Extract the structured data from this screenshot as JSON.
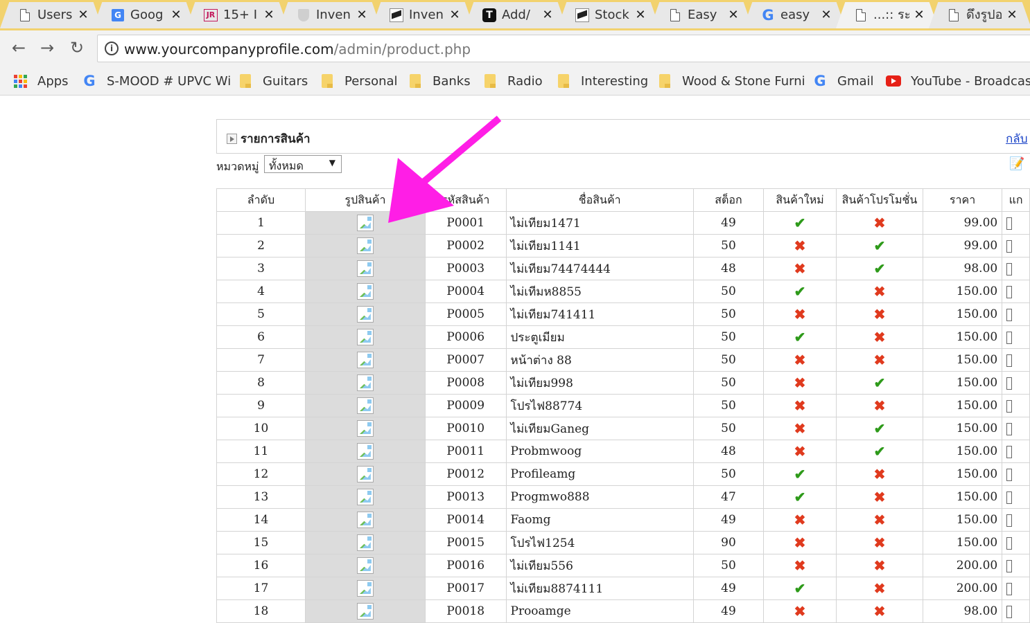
{
  "browser": {
    "tabs": [
      {
        "title": "Users",
        "icon": "document-icon",
        "active": false
      },
      {
        "title": "Goog",
        "icon": "google-translate-icon",
        "active": false
      },
      {
        "title": "15+ I",
        "icon": "jr-icon",
        "active": false
      },
      {
        "title": "Inven",
        "icon": "shield-icon",
        "active": false
      },
      {
        "title": "Inven",
        "icon": "bird-icon",
        "active": false
      },
      {
        "title": "Add/",
        "icon": "t-icon",
        "active": false
      },
      {
        "title": "Stock",
        "icon": "bird-icon",
        "active": false
      },
      {
        "title": "Easy",
        "icon": "document-icon",
        "active": false
      },
      {
        "title": "easy",
        "icon": "google-icon",
        "active": false
      },
      {
        "title": "...:: ระบ",
        "icon": "document-icon",
        "active": true
      },
      {
        "title": "ดึงรูปอ",
        "icon": "document-icon",
        "active": false
      }
    ],
    "close_glyph": "✕",
    "url_host": "www.yourcompanyprofile.com",
    "url_path": "/admin/product.php",
    "bookmarks": [
      {
        "label": "Apps",
        "icon": "apps-grid-icon"
      },
      {
        "label": "S-MOOD # UPVC Wi",
        "icon": "google-icon"
      },
      {
        "label": "Guitars",
        "icon": "folder-icon"
      },
      {
        "label": "Personal",
        "icon": "folder-icon"
      },
      {
        "label": "Banks",
        "icon": "folder-icon"
      },
      {
        "label": "Radio",
        "icon": "folder-icon"
      },
      {
        "label": "Interesting",
        "icon": "folder-icon"
      },
      {
        "label": "Wood & Stone Furni",
        "icon": "folder-icon"
      },
      {
        "label": "Gmail",
        "icon": "google-icon"
      },
      {
        "label": "YouTube - Broadcast",
        "icon": "youtube-icon"
      }
    ]
  },
  "page": {
    "panel_title": "รายการสินค้า",
    "back_link": "กลับ",
    "category_label": "หมวดหมู่",
    "category_selected": "ทั้งหมด",
    "table": {
      "headers": [
        "ลำดับ",
        "รูปสินค้า",
        "รหัสสินค้า",
        "ชื่อสินค้า",
        "สต็อก",
        "สินค้าใหม่",
        "สินค้าโปรโมชั่น",
        "ราคา",
        "แก"
      ],
      "rows": [
        {
          "no": "1",
          "code": "P0001",
          "name": "ไม่เทียม1471",
          "stock": "49",
          "is_new": true,
          "is_promo": false,
          "price": "99.00"
        },
        {
          "no": "2",
          "code": "P0002",
          "name": "ไม่เทียม1141",
          "stock": "50",
          "is_new": false,
          "is_promo": true,
          "price": "99.00"
        },
        {
          "no": "3",
          "code": "P0003",
          "name": "ไม่เทียม74474444",
          "stock": "48",
          "is_new": false,
          "is_promo": true,
          "price": "98.00"
        },
        {
          "no": "4",
          "code": "P0004",
          "name": "ไม่เทีมห8855",
          "stock": "50",
          "is_new": true,
          "is_promo": false,
          "price": "150.00"
        },
        {
          "no": "5",
          "code": "P0005",
          "name": "ไม่เทียม741411",
          "stock": "50",
          "is_new": false,
          "is_promo": false,
          "price": "150.00"
        },
        {
          "no": "6",
          "code": "P0006",
          "name": "ประตูเมียม",
          "stock": "50",
          "is_new": true,
          "is_promo": false,
          "price": "150.00"
        },
        {
          "no": "7",
          "code": "P0007",
          "name": "หน้าต่าง 88",
          "stock": "50",
          "is_new": false,
          "is_promo": false,
          "price": "150.00"
        },
        {
          "no": "8",
          "code": "P0008",
          "name": "ไม่เทียม998",
          "stock": "50",
          "is_new": false,
          "is_promo": true,
          "price": "150.00"
        },
        {
          "no": "9",
          "code": "P0009",
          "name": "โปรไฟ88774",
          "stock": "50",
          "is_new": false,
          "is_promo": false,
          "price": "150.00"
        },
        {
          "no": "10",
          "code": "P0010",
          "name": "ไม่เทียมGaneg",
          "stock": "50",
          "is_new": false,
          "is_promo": true,
          "price": "150.00"
        },
        {
          "no": "11",
          "code": "P0011",
          "name": "Probmwoog",
          "stock": "48",
          "is_new": false,
          "is_promo": true,
          "price": "150.00"
        },
        {
          "no": "12",
          "code": "P0012",
          "name": "Profileamg",
          "stock": "50",
          "is_new": true,
          "is_promo": false,
          "price": "150.00"
        },
        {
          "no": "13",
          "code": "P0013",
          "name": "Progmwo888",
          "stock": "47",
          "is_new": true,
          "is_promo": false,
          "price": "150.00"
        },
        {
          "no": "14",
          "code": "P0014",
          "name": "Faomg",
          "stock": "49",
          "is_new": false,
          "is_promo": false,
          "price": "150.00"
        },
        {
          "no": "15",
          "code": "P0015",
          "name": "โปรไฟ1254",
          "stock": "90",
          "is_new": false,
          "is_promo": false,
          "price": "150.00"
        },
        {
          "no": "16",
          "code": "P0016",
          "name": "ไม่เทียม556",
          "stock": "50",
          "is_new": false,
          "is_promo": false,
          "price": "200.00"
        },
        {
          "no": "17",
          "code": "P0017",
          "name": "ไม่เทียม8874111",
          "stock": "49",
          "is_new": true,
          "is_promo": false,
          "price": "200.00"
        },
        {
          "no": "18",
          "code": "P0018",
          "name": "Prooamge",
          "stock": "49",
          "is_new": false,
          "is_promo": false,
          "price": "98.00"
        }
      ]
    }
  },
  "annotation": {
    "arrow_color": "#ff1ee6"
  },
  "colors": {
    "tabstrip": "#f2d26e",
    "check": "#2e9a1a",
    "cross": "#e03a1e",
    "link": "#1a43c8"
  }
}
